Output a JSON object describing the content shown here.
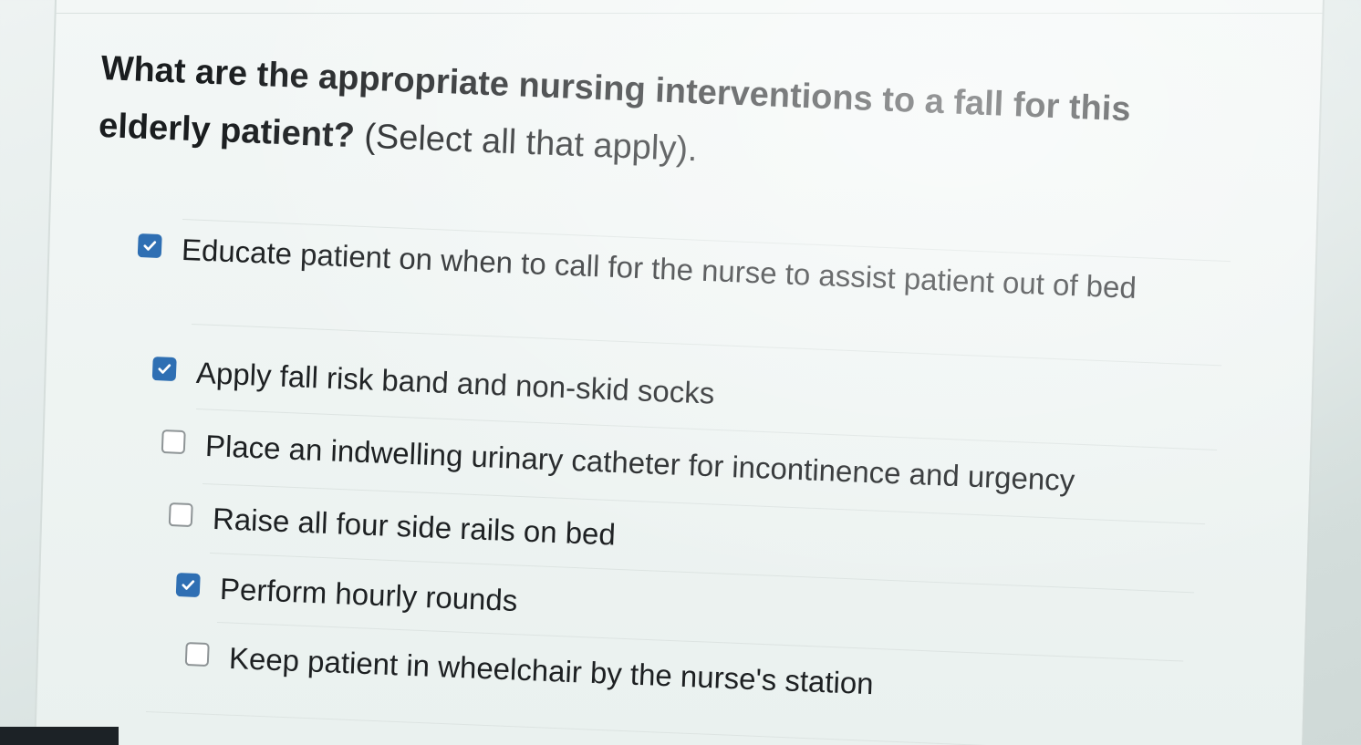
{
  "question": {
    "bold_text": "What are the appropriate nursing interventions to a fall for this elderly patient?",
    "instruction_text": " (Select all that apply)."
  },
  "options": [
    {
      "label": "Educate patient on when to call for the nurse to assist patient out of bed",
      "checked": true
    },
    {
      "label": "Apply fall risk band and non-skid socks",
      "checked": true
    },
    {
      "label": "Place an indwelling urinary catheter for incontinence and urgency",
      "checked": false
    },
    {
      "label": "Raise all four side rails on bed",
      "checked": false
    },
    {
      "label": "Perform hourly rounds",
      "checked": true
    },
    {
      "label": "Keep patient in wheelchair by the nurse's station",
      "checked": false
    }
  ],
  "colors": {
    "checkbox_checked": "#2f6fb3",
    "text": "#1d2022"
  }
}
